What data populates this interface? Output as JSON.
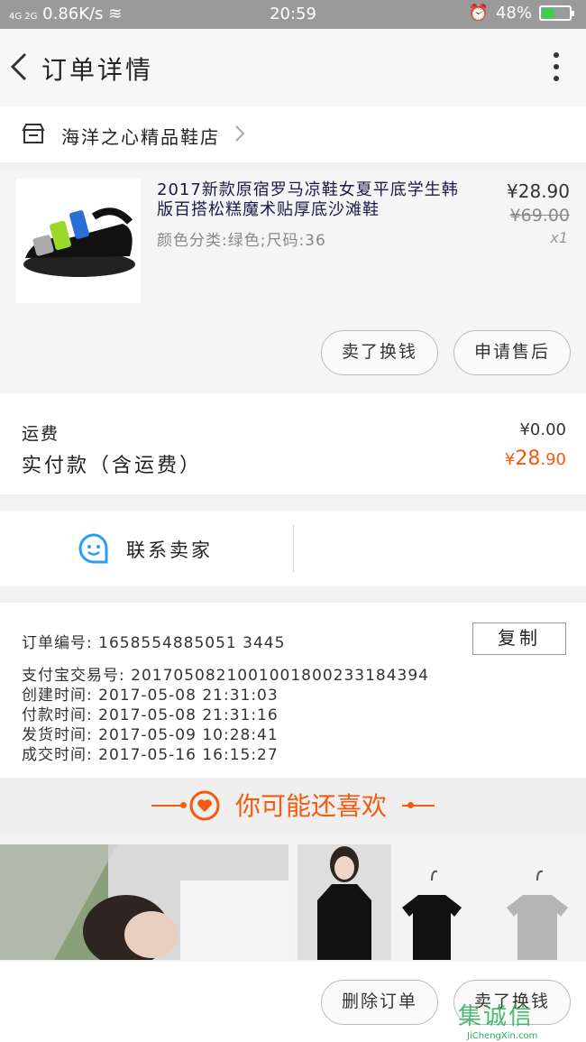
{
  "status_bar": {
    "network": "4G 2G",
    "speed": "0.86K/s",
    "time": "20:59",
    "battery": "48%",
    "battery_level": 0.48
  },
  "header": {
    "title": "订单详情"
  },
  "shop": {
    "name": "海洋之心精品鞋店"
  },
  "product": {
    "name": "2017新款原宿罗马凉鞋女夏平底学生韩版百搭松糕魔术贴厚底沙滩鞋",
    "spec": "颜色分类:绿色;尺码:36",
    "price": "¥28.90",
    "original_price": "¥69.00",
    "quantity": "x1",
    "exchange_button": "卖了换钱",
    "after_sale_button": "申请售后"
  },
  "fees": {
    "shipping_label": "运费",
    "shipping_value": "¥0.00",
    "paid_label": "实付款（含运费）",
    "paid_currency": "¥",
    "paid_int": "28",
    "paid_dec": ".90"
  },
  "contact": {
    "label": "联系卖家"
  },
  "order_info": {
    "order_no": "订单编号:   1658554885051344 5",
    "copy_button": "复制",
    "rows": [
      "订单编号:   1658554885051 3445",
      "支付宝交易号:   2017050821001001800233184394",
      "创建时间:   2017-05-08  21:31:03",
      "付款时间:   2017-05-08  21:31:16",
      "发货时间:   2017-05-09  10:28:41",
      "成交时间:   2017-05-16  16:15:27"
    ]
  },
  "recommend": {
    "title": "你可能还喜欢"
  },
  "bottom_bar": {
    "delete_button": "删除订单",
    "exchange_button": "卖了换钱"
  },
  "watermark": {
    "text": "JiChengXin.com",
    "glyphs": "集诚信"
  },
  "colors": {
    "accent": "#f55a0e",
    "chat_icon": "#2a9df4"
  }
}
